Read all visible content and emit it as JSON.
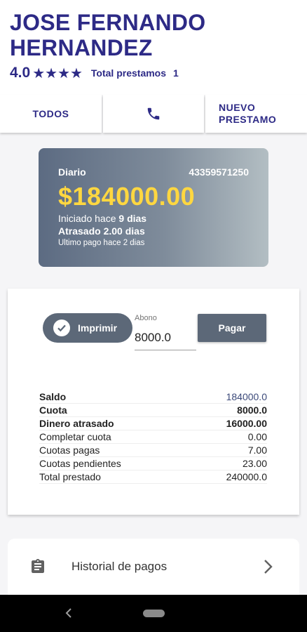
{
  "client": {
    "name": "JOSE FERNANDO HERNANDEZ",
    "rating": "4.0",
    "stars": "★★★★",
    "total_loans_label": "Total prestamos",
    "total_loans_count": "1"
  },
  "tabs": {
    "all_label": "TODOS",
    "call_icon": "phone-icon",
    "new_loan_line1": "NUEVO",
    "new_loan_line2": "PRESTAMO"
  },
  "loan": {
    "frequency": "Diario",
    "loan_number": "43359571250",
    "amount": "$184000.00",
    "started_prefix": "Iniciado hace",
    "started_days": "9 dias",
    "overdue": "Atrasado 2.00 dias",
    "last_payment": "Ultimo pago hace 2 dias",
    "card_gradient": [
      "#5c6b82",
      "#b3bec3"
    ],
    "amount_color": "#ffd740"
  },
  "payment": {
    "print_label": "Imprimir",
    "print_checked": true,
    "abono_label": "Abono",
    "abono_value": "8000.0",
    "pay_label": "Pagar"
  },
  "summary": [
    {
      "label": "Saldo",
      "value": "184000.0",
      "bold": true
    },
    {
      "label": "Cuota",
      "value": "8000.0",
      "bold": true
    },
    {
      "label": "Dinero atrasado",
      "value": "16000.00",
      "bold": true
    },
    {
      "label": "Completar cuota",
      "value": "0.00",
      "bold": false
    },
    {
      "label": "Cuotas pagas",
      "value": "7.00",
      "bold": false
    },
    {
      "label": "Cuotas pendientes",
      "value": "23.00",
      "bold": false
    },
    {
      "label": "Total prestado",
      "value": "240000.0",
      "bold": false
    }
  ],
  "history": {
    "label": "Historial de pagos",
    "icon": "clipboard-icon"
  },
  "colors": {
    "primary": "#2d2a86",
    "button": "#5c6878"
  }
}
